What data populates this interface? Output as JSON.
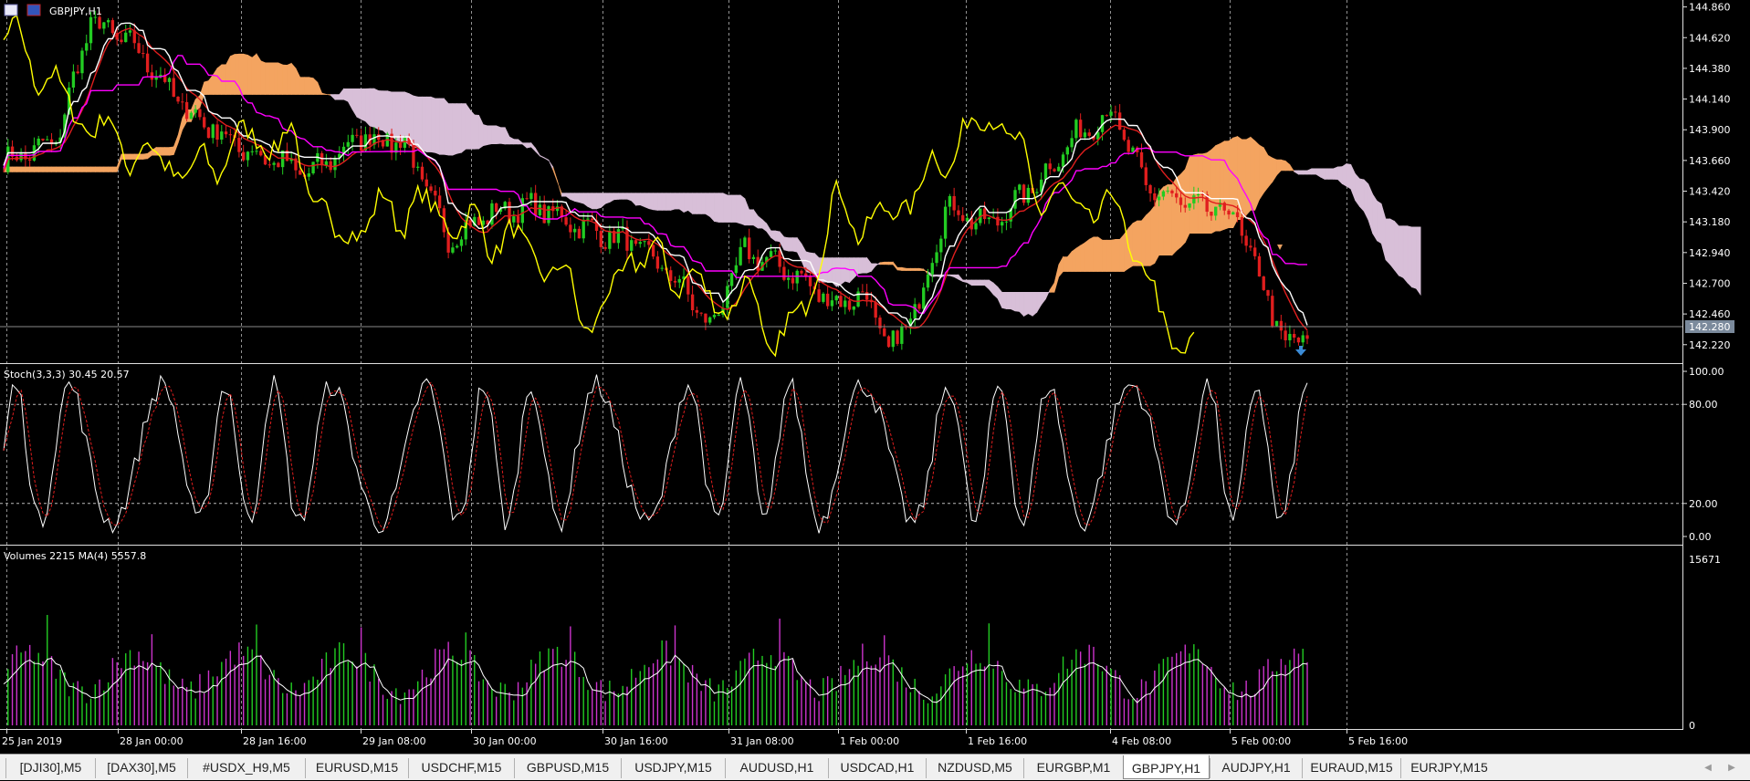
{
  "window": {
    "title": "GBPJPY,H1",
    "icons": [
      "chart-window-icon",
      "flag-icon"
    ]
  },
  "colors": {
    "background": "#000000",
    "grid": "#d0d0d0",
    "bull_candle": "#22cc22",
    "bear_candle": "#e01e1e",
    "cloud_bull": "#f4a460",
    "cloud_bear": "#d8bfd8",
    "tenkan": "#ffffff",
    "kijun": "#ff00ff",
    "chikou": "#ffff00",
    "ma_red": "#e01e1e",
    "vol_up": "#22cc22",
    "vol_down": "#cc33cc",
    "price_tag_bg": "#7b8a9c"
  },
  "main_panel": {
    "price_scale": [
      "144.860",
      "144.620",
      "144.380",
      "144.140",
      "143.900",
      "143.660",
      "143.420",
      "143.180",
      "142.940",
      "142.700",
      "142.460",
      "142.220"
    ],
    "current_price": "142.280",
    "ylim": [
      142.09,
      144.9
    ]
  },
  "stoch_panel": {
    "label": "Stoch(3,3,3) 30.45 20.57",
    "scale": [
      "100.00",
      "80.00",
      "20.00",
      "0.00"
    ]
  },
  "volume_panel": {
    "label": "Volumes 2215 MA(4) 5557.8",
    "scale": [
      "15671",
      "0"
    ]
  },
  "time_axis": {
    "labels": [
      "25 Jan 2019",
      "28 Jan 00:00",
      "28 Jan 16:00",
      "29 Jan 08:00",
      "30 Jan 00:00",
      "30 Jan 16:00",
      "31 Jan 08:00",
      "1 Feb 00:00",
      "1 Feb 16:00",
      "4 Feb 08:00",
      "5 Feb 00:00",
      "5 Feb 16:00"
    ]
  },
  "tabs": [
    {
      "label": "[DJI30],M5",
      "active": false
    },
    {
      "label": "[DAX30],M5",
      "active": false
    },
    {
      "label": "#USDX_H9,M5",
      "active": false
    },
    {
      "label": "EURUSD,M15",
      "active": false
    },
    {
      "label": "USDCHF,M15",
      "active": false
    },
    {
      "label": "GBPUSD,M15",
      "active": false
    },
    {
      "label": "USDJPY,M15",
      "active": false
    },
    {
      "label": "AUDUSD,H1",
      "active": false
    },
    {
      "label": "USDCAD,H1",
      "active": false
    },
    {
      "label": "NZDUSD,M5",
      "active": false
    },
    {
      "label": "EURGBP,M1",
      "active": false
    },
    {
      "label": "GBPJPY,H1",
      "active": true
    },
    {
      "label": "AUDJPY,H1",
      "active": false
    },
    {
      "label": "EURAUD,M15",
      "active": false
    },
    {
      "label": "EURJPY,M15",
      "active": false
    }
  ],
  "tab_nav": [
    "scroll-left-icon",
    "scroll-right-icon"
  ]
}
